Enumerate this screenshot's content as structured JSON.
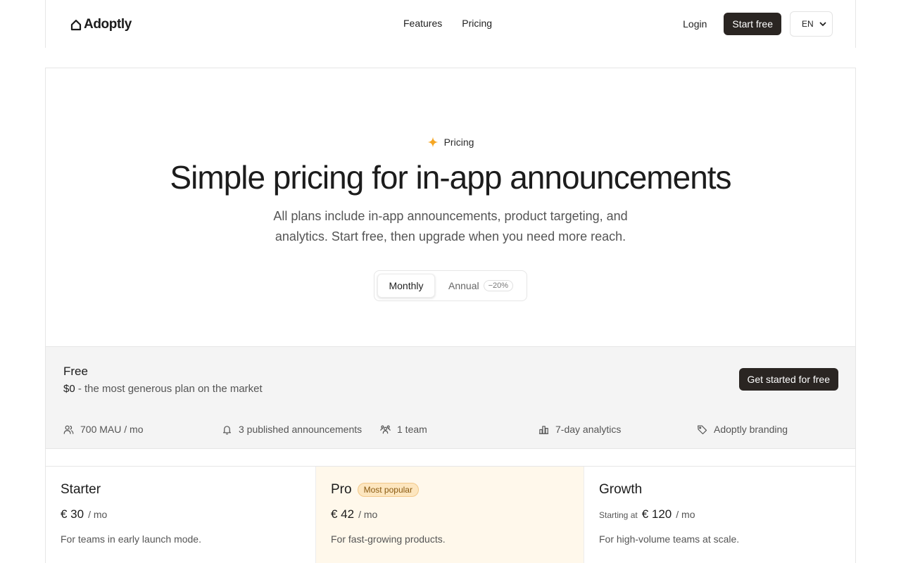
{
  "nav": {
    "logo": "Adoptly",
    "links": [
      "Features",
      "Pricing"
    ],
    "login": "Login",
    "start_free": "Start free",
    "lang": "EN"
  },
  "hero": {
    "eyebrow": "Pricing",
    "title": "Simple pricing for in-app announcements",
    "subtitle": "All plans include in-app announcements, product targeting, and analytics. Start free, then upgrade when you need more reach."
  },
  "billing_toggle": {
    "monthly": "Monthly",
    "annual": "Annual",
    "annual_discount": "−20%",
    "selected": "Monthly"
  },
  "free_plan": {
    "name": "Free",
    "price": "$0",
    "tagline": " - the most generous plan on the market",
    "cta": "Get started for free",
    "features": [
      {
        "icon": "users-icon",
        "text": "700 MAU / mo"
      },
      {
        "icon": "bell-icon",
        "text": "3 published announcements"
      },
      {
        "icon": "team-icon",
        "text": "1 team"
      },
      {
        "icon": "bar-chart-icon",
        "text": "7-day analytics"
      },
      {
        "icon": "tag-icon",
        "text": "Adoptly branding"
      }
    ]
  },
  "plans": [
    {
      "name": "Starter",
      "prefix": "",
      "price": "€ 30",
      "per": "/ mo",
      "desc": "For teams in early launch mode.",
      "badge": ""
    },
    {
      "name": "Pro",
      "prefix": "",
      "price": "€ 42",
      "per": "/ mo",
      "desc": "For fast-growing products.",
      "badge": "Most popular"
    },
    {
      "name": "Growth",
      "prefix": "Starting at",
      "price": "€ 120",
      "per": "/ mo",
      "desc": "For high-volume teams at scale.",
      "badge": ""
    }
  ],
  "colors": {
    "dark_button": "#2a2522",
    "accent_star": "#f5a623",
    "pro_bg": "#fff8eb",
    "free_bg": "#f4f4f4"
  }
}
